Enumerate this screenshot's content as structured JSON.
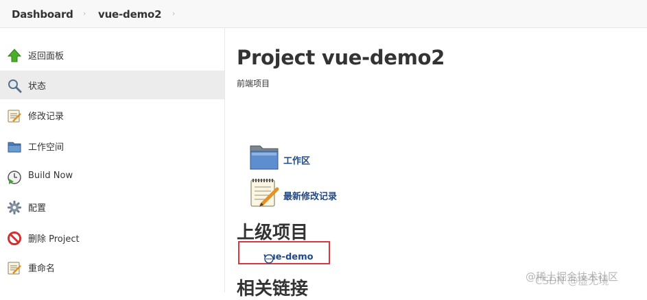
{
  "breadcrumb": {
    "items": [
      {
        "label": "Dashboard"
      },
      {
        "label": "vue-demo2"
      }
    ],
    "separator": "›"
  },
  "sidebar": {
    "items": [
      {
        "label": "返回面板",
        "icon": "up-arrow-icon"
      },
      {
        "label": "状态",
        "icon": "search-icon",
        "active": true
      },
      {
        "label": "修改记录",
        "icon": "notepad-icon"
      },
      {
        "label": "工作空间",
        "icon": "folder-icon"
      },
      {
        "label": "Build Now",
        "icon": "clock-play-icon"
      },
      {
        "label": "配置",
        "icon": "gear-icon"
      },
      {
        "label": "删除 Project",
        "icon": "no-entry-icon"
      },
      {
        "label": "重命名",
        "icon": "notepad-icon"
      }
    ]
  },
  "main": {
    "title": "Project vue-demo2",
    "description": "前端项目",
    "tasks": [
      {
        "label": "工作区",
        "icon": "folder-icon"
      },
      {
        "label": "最新修改记录",
        "icon": "notepad-icon"
      }
    ],
    "upstream_heading": "上级项目",
    "upstream_link": "vue-demo",
    "related_heading": "相关链接"
  },
  "watermark": {
    "line1": "@稀土掘金技术社区",
    "line2": "CSDN @虚无境"
  },
  "colors": {
    "link": "#204a87",
    "highlight_border": "#d9363e",
    "active_bg": "#ececec"
  }
}
